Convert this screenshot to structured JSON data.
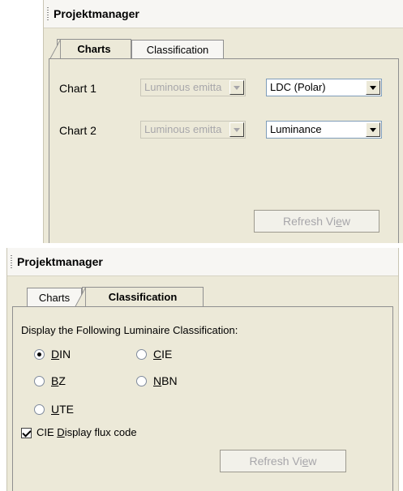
{
  "panel1": {
    "title": "Projektmanager",
    "tabs": [
      {
        "label": "Charts",
        "active": true
      },
      {
        "label": "Classification",
        "active": false
      }
    ],
    "chart1": {
      "label": "Chart 1",
      "left_value": "Luminous emitta",
      "right_value": "LDC (Polar)"
    },
    "chart2": {
      "label": "Chart 2",
      "left_value": "Luminous emitta",
      "right_value": "Luminance"
    },
    "refresh_button": {
      "pre": "Refresh Vi",
      "ul": "e",
      "post": "w"
    }
  },
  "panel2": {
    "title": "Projektmanager",
    "tabs": [
      {
        "label": "Charts",
        "active": false
      },
      {
        "label": "Classification",
        "active": true
      }
    ],
    "heading": "Display the Following Luminaire Classification:",
    "options": {
      "din": {
        "ul": "D",
        "rest": "IN",
        "selected": true
      },
      "cie": {
        "ul": "C",
        "rest": "IE",
        "selected": false
      },
      "bz": {
        "ul": "B",
        "rest": "Z",
        "selected": false
      },
      "nbn": {
        "ul": "N",
        "rest": "BN",
        "selected": false
      },
      "ute": {
        "ul": "U",
        "rest": "TE",
        "selected": false
      }
    },
    "checkbox": {
      "pre": "CIE ",
      "ul": "D",
      "post": "isplay flux code",
      "checked": true
    },
    "refresh_button": {
      "pre": "Refresh Vi",
      "ul": "e",
      "post": "w"
    }
  }
}
